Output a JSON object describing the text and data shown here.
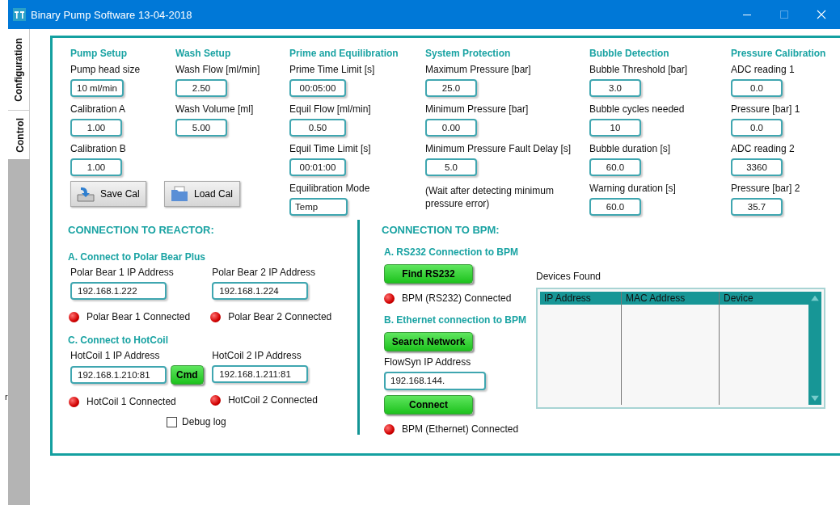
{
  "window": {
    "title": "Binary Pump Software 13-04-2018"
  },
  "tabs": [
    {
      "label": "Configuration",
      "selected": true
    },
    {
      "label": "Control",
      "selected": false
    }
  ],
  "left_edge_text": "r",
  "setup_sections": [
    {
      "heading": "Pump Setup",
      "items": [
        {
          "kind": "field",
          "label": "Pump head size",
          "value": "10 ml/min"
        },
        {
          "kind": "field",
          "label": "Calibration A",
          "value": "1.00"
        },
        {
          "kind": "field",
          "label": "Calibration B",
          "value": "1.00"
        }
      ]
    },
    {
      "heading": "Wash Setup",
      "items": [
        {
          "kind": "field",
          "label": "Wash Flow [ml/min]",
          "value": "2.50"
        },
        {
          "kind": "field",
          "label": "Wash Volume [ml]",
          "value": "5.00"
        }
      ]
    },
    {
      "heading": "Prime and Equilibration",
      "items": [
        {
          "kind": "field",
          "label": "Prime Time Limit [s]",
          "value": "00:05:00"
        },
        {
          "kind": "field",
          "label": "Equil Flow [ml/min]",
          "value": "0.50"
        },
        {
          "kind": "field",
          "label": "Equil Time Limit [s]",
          "value": "00:01:00"
        },
        {
          "kind": "select",
          "label": "Equilibration Mode",
          "value": "Temp"
        }
      ]
    },
    {
      "heading": "System Protection",
      "items": [
        {
          "kind": "field",
          "label": "Maximum Pressure [bar]",
          "value": "25.0"
        },
        {
          "kind": "field",
          "label": "Minimum Pressure [bar]",
          "value": "0.00"
        },
        {
          "kind": "field",
          "label": "Minimum Pressure Fault Delay [s]",
          "value": "5.0"
        },
        {
          "kind": "note",
          "label": "(Wait after detecting minimum pressure error)"
        }
      ]
    },
    {
      "heading": "Bubble Detection",
      "items": [
        {
          "kind": "field",
          "label": "Bubble Threshold [bar]",
          "value": "3.0"
        },
        {
          "kind": "field",
          "label": "Bubble cycles needed",
          "value": "10"
        },
        {
          "kind": "field",
          "label": "Bubble duration [s]",
          "value": "60.0"
        },
        {
          "kind": "field",
          "label": "Warning duration [s]",
          "value": "60.0"
        }
      ]
    },
    {
      "heading": "Pressure Calibration",
      "items": [
        {
          "kind": "field",
          "label": "ADC reading 1",
          "value": "0.0"
        },
        {
          "kind": "field",
          "label": "Pressure [bar] 1",
          "value": "0.0"
        },
        {
          "kind": "field",
          "label": "ADC reading 2",
          "value": "3360"
        },
        {
          "kind": "field",
          "label": "Pressure [bar] 2",
          "value": "35.7"
        }
      ]
    }
  ],
  "cal_buttons": [
    {
      "kind": "save",
      "label": "Save Cal"
    },
    {
      "kind": "load",
      "label": "Load Cal"
    }
  ],
  "reactor": {
    "heading": "CONNECTION TO REACTOR:",
    "groups": [
      {
        "heading": "A. Connect to Polar Bear Plus",
        "devices": [
          {
            "label": "Polar Bear 1 IP Address",
            "value": "192.168.1.222",
            "status": "Polar Bear 1 Connected",
            "connected": false
          },
          {
            "label": "Polar Bear 2 IP Address",
            "value": "192.168.1.224",
            "status": "Polar Bear 2 Connected",
            "connected": false
          }
        ]
      },
      {
        "heading": "C. Connect to HotCoil",
        "devices": [
          {
            "label": "HotCoil 1 IP Address",
            "value": "192.168.1.210:81",
            "button": "Cmd",
            "status": "HotCoil 1 Connected",
            "connected": false
          },
          {
            "label": "HotCoil 2 IP Address",
            "value": "192.168.1.211:81",
            "status": "HotCoil 2 Connected",
            "connected": false
          }
        ]
      }
    ],
    "debug_log": {
      "label": "Debug log",
      "checked": false
    }
  },
  "bpm": {
    "heading": "CONNECTION TO BPM:",
    "rs232": {
      "heading": "A. RS232 Connection to BPM",
      "button": "Find RS232",
      "status": "BPM (RS232) Connected",
      "connected": false
    },
    "ethernet": {
      "heading": "B. Ethernet connection to BPM",
      "button": "Search Network",
      "field_label": "FlowSyn IP Address",
      "value": "192.168.144.",
      "connect_button": "Connect",
      "status": "BPM (Ethernet) Connected",
      "connected": false
    },
    "devices_found": {
      "title": "Devices Found",
      "columns": [
        "IP Address",
        "MAC Address",
        "Device"
      ]
    }
  }
}
